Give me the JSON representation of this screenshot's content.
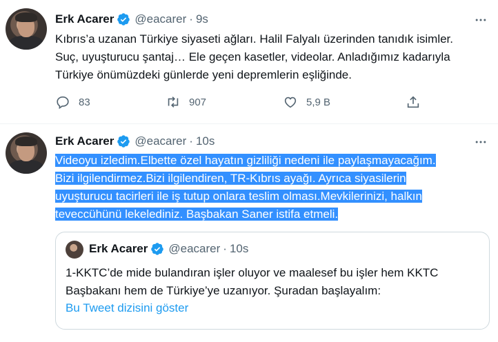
{
  "tweets": [
    {
      "author_name": "Erk Acarer",
      "handle": "@eacarer",
      "separator": "·",
      "time": "9s",
      "text_lines": [
        "Kıbrıs’a uzanan Türkiye siyaseti ağları. Halil Falyalı üzerinden tanıdık isimler.",
        "Suç, uyuşturucu şantaj… Ele geçen kasetler, videolar. Anladığımız kadarıyla",
        "Türkiye önümüzdeki günlerde yeni depremlerin eşliğinde."
      ],
      "reply_count": "83",
      "retweet_count": "907",
      "like_count": "5,9 B"
    },
    {
      "author_name": "Erk Acarer",
      "handle": "@eacarer",
      "separator": "·",
      "time": "10s",
      "text_lines": [
        "Videoyu izledim.Elbette özel hayatın gizliliği nedeni ile paylaşmayacağım.",
        "Bizi ilgilendirmez.Bizi ilgilendiren, TR-Kıbrıs ayağı. Ayrıca siyasilerin",
        "uyuşturucu tacirleri ile iş tutup onlara teslim olması.Mevkilerinizi, halkın",
        "teveccühünü lekelediniz. Başbakan Saner istifa etmeli."
      ],
      "quoted": {
        "author_name": "Erk Acarer",
        "handle": "@eacarer",
        "separator": "·",
        "time": "10s",
        "text_lines": [
          "1-KKTC’de mide bulandıran işler oluyor ve maalesef bu işler hem KKTC",
          "Başbakanı hem de Türkiye’ye uzanıyor. Şuradan başlayalım:"
        ],
        "thread_link": "Bu Tweet dizisini göster"
      }
    }
  ],
  "colors": {
    "text": "#0f1419",
    "secondary": "#536471",
    "link": "#1d9bf0",
    "verified": "#1d9bf0",
    "selection": "#3390ff"
  },
  "icons": [
    "reply-icon",
    "retweet-icon",
    "like-icon",
    "share-icon",
    "more-icon",
    "verified-badge-icon"
  ]
}
